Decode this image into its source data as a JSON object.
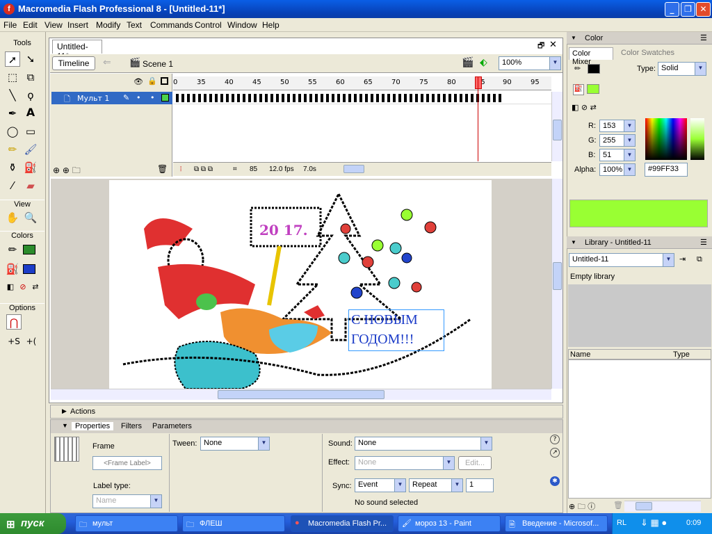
{
  "window": {
    "title": "Macromedia Flash Professional 8 - [Untitled-11*]",
    "app_icon": "flash-icon"
  },
  "menu": [
    "File",
    "Edit",
    "View",
    "Insert",
    "Modify",
    "Text",
    "Commands",
    "Control",
    "Window",
    "Help"
  ],
  "tools": {
    "header": "Tools",
    "view_header": "View",
    "colors_header": "Colors",
    "options_header": "Options"
  },
  "document": {
    "tab": "Untitled-11*",
    "scene": "Scene 1",
    "timeline_button": "Timeline",
    "zoom": "100%"
  },
  "timeline": {
    "ruler": [
      "0",
      "35",
      "40",
      "45",
      "50",
      "55",
      "60",
      "65",
      "70",
      "75",
      "80",
      "85",
      "90",
      "95"
    ],
    "layer_name": "Мульт 1",
    "current_frame": "85",
    "fps": "12.0 fps",
    "time": "7.0s"
  },
  "stage": {
    "year_sign": "20 17.",
    "greeting_line1": "С НОВЫМ",
    "greeting_line2": "ГОДОМ!!!"
  },
  "actions_label": "Actions",
  "properties": {
    "tabs": [
      "Properties",
      "Filters",
      "Parameters"
    ],
    "frame_label": "Frame",
    "frame_placeholder": "<Frame Label>",
    "label_type": "Label type:",
    "label_type_value": "Name",
    "tween_label": "Tween:",
    "tween_value": "None",
    "sound_label": "Sound:",
    "sound_value": "None",
    "effect_label": "Effect:",
    "effect_value": "None",
    "edit_button": "Edit...",
    "sync_label": "Sync:",
    "sync_value": "Event",
    "repeat_value": "Repeat",
    "repeat_count": "1",
    "no_sound": "No sound selected"
  },
  "color_panel": {
    "title": "Color",
    "tab_mixer": "Color Mixer",
    "tab_swatches": "Color Swatches",
    "type_label": "Type:",
    "type_value": "Solid",
    "r_label": "R:",
    "r": "153",
    "g_label": "G:",
    "g": "255",
    "b_label": "B:",
    "b": "51",
    "alpha_label": "Alpha:",
    "alpha": "100%",
    "hex": "#99FF33",
    "fill_color": "#99FF33",
    "stroke_color": "#000000"
  },
  "library": {
    "title": "Library - Untitled-11",
    "doc": "Untitled-11",
    "empty": "Empty library",
    "col_name": "Name",
    "col_type": "Type"
  },
  "taskbar": {
    "start": "пуск",
    "tasks": [
      "мульт",
      "ФЛЕШ",
      "Macromedia Flash Pr...",
      "мороз 13 - Paint",
      "Введение - Microsof..."
    ],
    "lang": "RL",
    "clock": "0:09"
  }
}
